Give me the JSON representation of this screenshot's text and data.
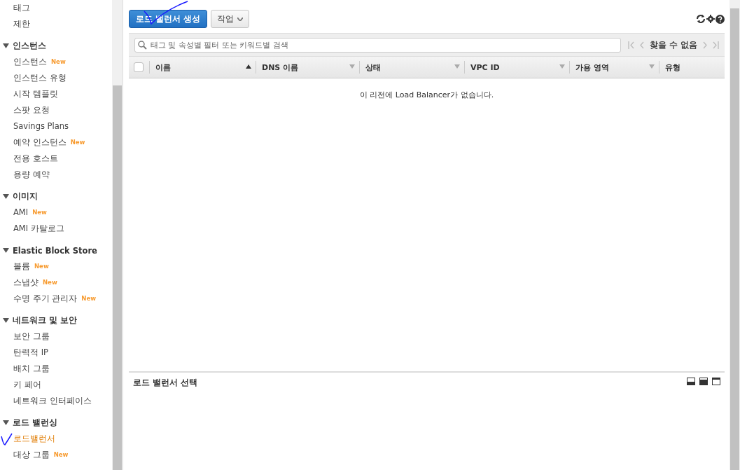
{
  "sidebar": {
    "top_items": [
      {
        "label": "태그",
        "selected": false
      },
      {
        "label": "제한",
        "selected": false
      }
    ],
    "sections": [
      {
        "title": "인스턴스",
        "expanded": true,
        "items": [
          {
            "label": "인스턴스",
            "badge": "New",
            "selected": false
          },
          {
            "label": "인스턴스 유형",
            "selected": false
          },
          {
            "label": "시작 템플릿",
            "selected": false
          },
          {
            "label": "스팟 요청",
            "selected": false
          },
          {
            "label": "Savings Plans",
            "selected": false
          },
          {
            "label": "예약 인스턴스",
            "badge": "New",
            "selected": false
          },
          {
            "label": "전용 호스트",
            "selected": false
          },
          {
            "label": "용량 예약",
            "selected": false
          }
        ]
      },
      {
        "title": "이미지",
        "expanded": true,
        "items": [
          {
            "label": "AMI",
            "badge": "New",
            "selected": false
          },
          {
            "label": "AMI 카탈로그",
            "selected": false
          }
        ]
      },
      {
        "title": "Elastic Block Store",
        "expanded": true,
        "items": [
          {
            "label": "볼륨",
            "badge": "New",
            "selected": false
          },
          {
            "label": "스냅샷",
            "badge": "New",
            "selected": false
          },
          {
            "label": "수명 주기 관리자",
            "badge": "New",
            "selected": false
          }
        ]
      },
      {
        "title": "네트워크 및 보안",
        "expanded": true,
        "items": [
          {
            "label": "보안 그룹",
            "selected": false
          },
          {
            "label": "탄력적 IP",
            "selected": false
          },
          {
            "label": "배치 그룹",
            "selected": false
          },
          {
            "label": "키 페어",
            "selected": false
          },
          {
            "label": "네트워크 인터페이스",
            "selected": false
          }
        ]
      },
      {
        "title": "로드 밸런싱",
        "expanded": true,
        "items": [
          {
            "label": "로드밸런서",
            "selected": true
          },
          {
            "label": "대상 그룹",
            "badge": "New",
            "selected": false
          }
        ]
      }
    ]
  },
  "toolbar": {
    "primary_button": "로드 밸런서 생성",
    "actions_button": "작업"
  },
  "filter": {
    "placeholder": "태그 및 속성별 필터 또는 키워드별 검색",
    "pagination": "찾을 수 없음"
  },
  "table": {
    "select_all_checked": false,
    "columns": [
      {
        "label": "이름",
        "sorted": true
      },
      {
        "label": "DNS 이름",
        "sorted": false
      },
      {
        "label": "상태",
        "sorted": false
      },
      {
        "label": "VPC ID",
        "sorted": false
      },
      {
        "label": "가용 영역",
        "sorted": false
      },
      {
        "label": "유형"
      }
    ],
    "empty_message": "이 리전에 Load Balancer가 없습니다."
  },
  "detail_pane": {
    "title": "로드 밸런서 선택"
  }
}
